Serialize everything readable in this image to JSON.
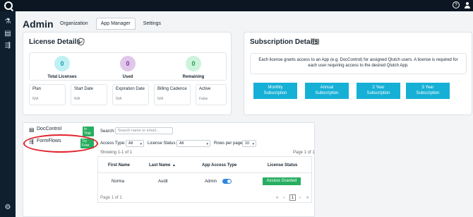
{
  "header": {
    "help_icon": "help-circle-icon",
    "user_icon": "user-icon"
  },
  "rail": {
    "icons": [
      "flask-icon",
      "book-icon",
      "flow-icon",
      "gear-icon"
    ]
  },
  "page": {
    "title": "Admin",
    "tabs": [
      "Organization",
      "App Manager",
      "Settings"
    ],
    "active_tab": 1
  },
  "license": {
    "title": "License Details",
    "stats": [
      {
        "value": "0",
        "label": "Total Licenses",
        "color": "#bff0f4"
      },
      {
        "value": "0",
        "label": "Used",
        "color": "#e0c6ea"
      },
      {
        "value": "0",
        "label": "Remaining",
        "color": "#ccf3dc"
      }
    ],
    "info": [
      {
        "label": "Plan",
        "value": "N/A"
      },
      {
        "label": "Start Date",
        "value": "N/A"
      },
      {
        "label": "Expiration Date",
        "value": "N/A"
      },
      {
        "label": "Billing Cadence",
        "value": "N/A"
      },
      {
        "label": "Active",
        "value": "False"
      }
    ]
  },
  "subscription": {
    "title": "Subscription Details",
    "description": "Each license grants access to an App (e.g. DocControl) for assigned Qlutch users. A license is required for each user requiring access to the desired Qlutch App.",
    "buttons": [
      {
        "line1": "Monthly",
        "line2": "Subscription"
      },
      {
        "line1": "Annual",
        "line2": "Subscription"
      },
      {
        "line1": "2 Year",
        "line2": "Subscription"
      },
      {
        "line1": "3 Year",
        "line2": "Subscription"
      }
    ]
  },
  "apps": [
    {
      "name": "DocControl",
      "badge": "In Trial",
      "icon": "document-icon"
    },
    {
      "name": "FormFlows",
      "badge": "Try Free",
      "icon": "flow-icon"
    }
  ],
  "filters": {
    "search_label": "Search:",
    "search_placeholder": "Search name or email...",
    "access_type_label": "Access Type:",
    "access_type_value": "All",
    "license_status_label": "License Status:",
    "license_status_value": "All",
    "rows_label": "Rows per page:",
    "rows_value": "10",
    "showing": "Showing 1-1 of 1",
    "page_info_top": "Page 1 of 1"
  },
  "table": {
    "columns": [
      "First Name",
      "Last Name",
      "App Access Type",
      "License Status"
    ],
    "sort_indicator": "▲",
    "rows": [
      {
        "first": "Norma",
        "last": "Audit",
        "access": "Admin",
        "status": "Access Granted"
      }
    ]
  },
  "pagination": {
    "info": "Page 1 of 1",
    "current": "1",
    "first": "«",
    "prev": "‹",
    "next": "›",
    "last": "»"
  }
}
